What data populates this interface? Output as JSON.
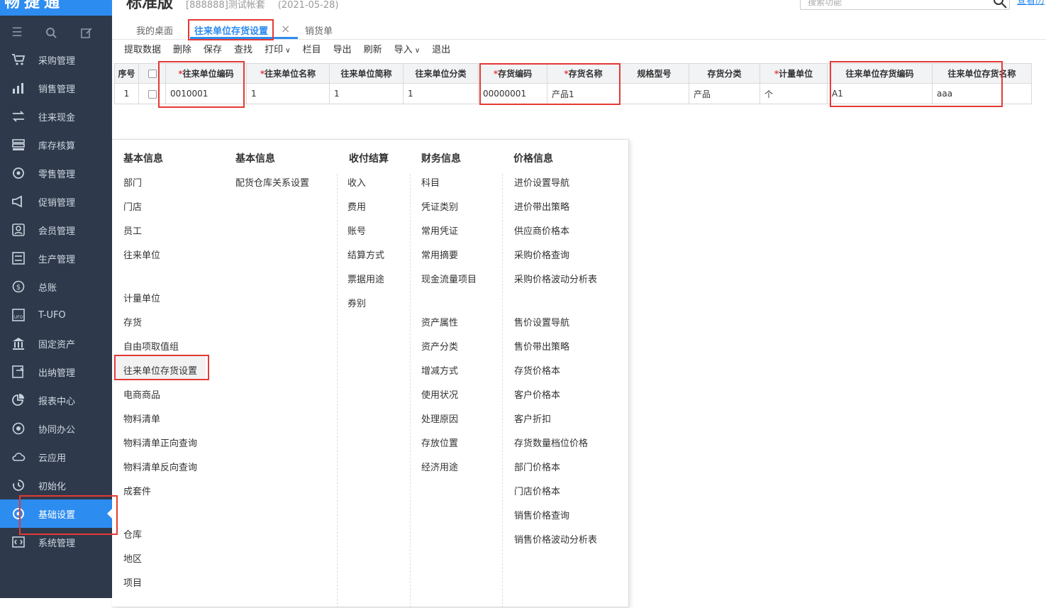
{
  "app": {
    "logo_text": "畅捷通",
    "edition": "标准版",
    "account": "[888888]测试帐套",
    "date": "(2021-05-28)",
    "search_placeholder": "搜索功能",
    "header_link": "查看历"
  },
  "sidebar": {
    "items": [
      {
        "label": "采购管理",
        "icon": "cart-icon"
      },
      {
        "label": "销售管理",
        "icon": "bar-chart-icon"
      },
      {
        "label": "往来现金",
        "icon": "exchange-icon"
      },
      {
        "label": "库存核算",
        "icon": "inventory-icon"
      },
      {
        "label": "零售管理",
        "icon": "retail-icon"
      },
      {
        "label": "促销管理",
        "icon": "megaphone-icon"
      },
      {
        "label": "会员管理",
        "icon": "member-icon"
      },
      {
        "label": "生产管理",
        "icon": "production-icon"
      },
      {
        "label": "总账",
        "icon": "ledger-icon"
      },
      {
        "label": "T-UFO",
        "icon": "ufo-icon"
      },
      {
        "label": "固定资产",
        "icon": "bank-icon"
      },
      {
        "label": "出纳管理",
        "icon": "cashier-icon"
      },
      {
        "label": "报表中心",
        "icon": "pie-chart-icon"
      },
      {
        "label": "协同办公",
        "icon": "collab-icon"
      },
      {
        "label": "云应用",
        "icon": "cloud-icon"
      },
      {
        "label": "初始化",
        "icon": "init-icon"
      },
      {
        "label": "基础设置",
        "icon": "settings-icon"
      },
      {
        "label": "系统管理",
        "icon": "code-icon"
      }
    ]
  },
  "tabs": [
    {
      "label": "我的桌面"
    },
    {
      "label": "往来单位存货设置"
    },
    {
      "label": "销货单"
    }
  ],
  "toolbar": [
    "提取数据",
    "删除",
    "保存",
    "查找",
    "打印",
    "栏目",
    "导出",
    "刷新",
    "导入",
    "退出"
  ],
  "table": {
    "headers": [
      "序号",
      "",
      "往来单位编码",
      "往来单位名称",
      "往来单位简称",
      "往来单位分类",
      "存货编码",
      "存货名称",
      "规格型号",
      "存货分类",
      "计量单位",
      "往来单位存货编码",
      "往来单位存货名称"
    ],
    "required": [
      false,
      false,
      true,
      true,
      false,
      false,
      true,
      true,
      false,
      false,
      true,
      false,
      false
    ],
    "rows": [
      [
        "1",
        "",
        "0010001",
        "1",
        "1",
        "1",
        "00000001",
        "产品1",
        "",
        "产品",
        "个",
        "A1",
        "aaa"
      ]
    ]
  },
  "menu": {
    "columns": [
      {
        "title": "基本信息",
        "items": [
          "部门",
          "门店",
          "员工",
          "往来单位",
          "",
          "计量单位",
          "存货",
          "自由项取值组",
          "往来单位存货设置",
          "电商商品",
          "物料清单",
          "物料清单正向查询",
          "物料清单反向查询",
          "成套件",
          "",
          "仓库",
          "地区",
          "项目"
        ]
      },
      {
        "title": "基本信息",
        "items": [
          "配货仓库关系设置"
        ]
      },
      {
        "title": "收付结算",
        "items": [
          "收入",
          "费用",
          "账号",
          "结算方式",
          "票据用途",
          "券别"
        ]
      },
      {
        "title": "财务信息",
        "items": [
          "科目",
          "凭证类别",
          "常用凭证",
          "常用摘要",
          "现金流量项目",
          "",
          "资产属性",
          "资产分类",
          "增减方式",
          "使用状况",
          "处理原因",
          "存放位置",
          "经济用途"
        ]
      },
      {
        "title": "价格信息",
        "items": [
          "进价设置导航",
          "进价带出策略",
          "供应商价格本",
          "采购价格查询",
          "采购价格波动分析表",
          "",
          "售价设置导航",
          "售价带出策略",
          "存货价格本",
          "客户价格本",
          "客户折扣",
          "存货数量档位价格",
          "部门价格本",
          "门店价格本",
          "销售价格查询",
          "销售价格波动分析表"
        ]
      }
    ]
  },
  "colors": {
    "accent": "#2d8cf0",
    "sidebar": "#2e3a4b",
    "highlight": "#e53935"
  }
}
